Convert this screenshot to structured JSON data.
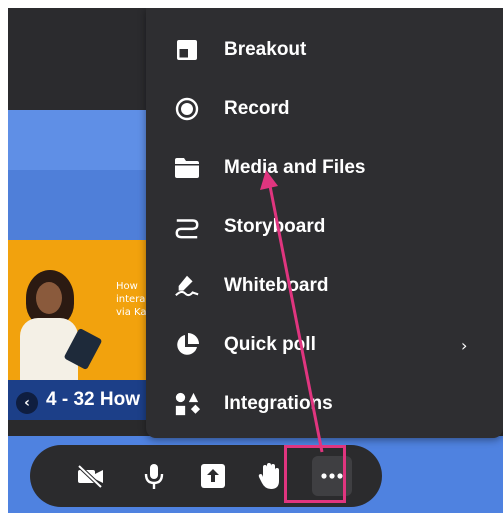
{
  "background": {
    "slide_text_lines": [
      "How",
      "intera",
      "via Ka"
    ],
    "nav_title": "4 - 32 How",
    "nav_prev_symbol": "‹"
  },
  "menu": {
    "items": [
      {
        "label": "Breakout",
        "icon": "breakout-icon"
      },
      {
        "label": "Record",
        "icon": "record-icon"
      },
      {
        "label": "Media and Files",
        "icon": "folder-icon"
      },
      {
        "label": "Storyboard",
        "icon": "storyboard-icon"
      },
      {
        "label": "Whiteboard",
        "icon": "whiteboard-icon"
      },
      {
        "label": "Quick poll",
        "icon": "pie-chart-icon",
        "submenu_arrow": "›"
      },
      {
        "label": "Integrations",
        "icon": "integrations-icon"
      }
    ]
  },
  "toolbar": {
    "buttons": [
      {
        "icon": "camera-off-icon"
      },
      {
        "icon": "microphone-icon"
      },
      {
        "icon": "share-screen-icon"
      },
      {
        "icon": "raise-hand-icon"
      },
      {
        "icon": "more-options-icon"
      }
    ]
  },
  "colors": {
    "menu_bg": "#2e2e31",
    "annotation": "#e0357f",
    "accent_blue": "#4f82e0",
    "slide_orange": "#f2a20d"
  }
}
